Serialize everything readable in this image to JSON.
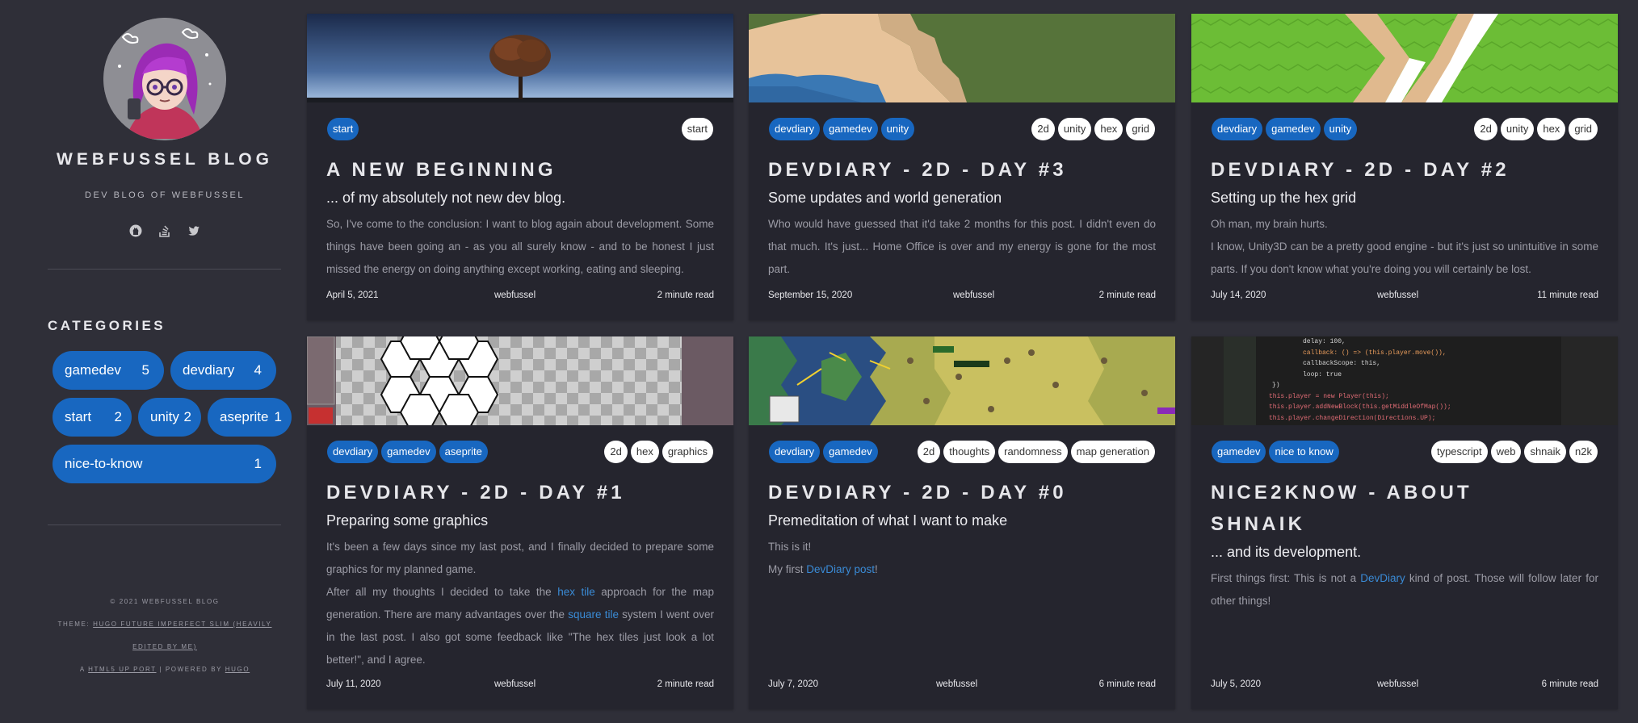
{
  "sidebar": {
    "title": "WEBFUSSEL BLOG",
    "subtitle": "DEV BLOG OF WEBFUSSEL",
    "social_icons": [
      "github-icon",
      "stack-overflow-icon",
      "twitter-icon"
    ],
    "categories_title": "CATEGORIES",
    "categories": [
      {
        "name": "gamedev",
        "count": "5"
      },
      {
        "name": "devdiary",
        "count": "4"
      },
      {
        "name": "start",
        "count": "2"
      },
      {
        "name": "unity",
        "count": "2"
      },
      {
        "name": "aseprite",
        "count": "1"
      },
      {
        "name": "nice-to-know",
        "count": "1"
      }
    ],
    "footer": {
      "copyright": "© 2021 WEBFUSSEL BLOG",
      "theme_prefix": "THEME:",
      "theme_link_1": "HUGO FUTURE IMPERFECT SLIM (HEAVILY",
      "theme_link_2": "EDITED BY ME)",
      "port_prefix": "A",
      "port_link": "HTML5 UP PORT",
      "powered": "| POWERED BY",
      "hugo_link": "HUGO"
    }
  },
  "posts": [
    {
      "title": "A NEW BEGINNING",
      "subtitle": "... of my absolutely not new dev blog.",
      "categories": [
        "start"
      ],
      "tags": [
        "start"
      ],
      "body": [
        "So, I've come to the conclusion: I want to blog again about development. Some things have been going an - as you all surely know - and to be honest I just missed the energy on doing anything except working, eating and sleeping."
      ],
      "date": "April 5, 2021",
      "author": "webfussel",
      "read": "2 minute read"
    },
    {
      "title": "DEVDIARY - 2D - DAY #3",
      "subtitle": "Some updates and world generation",
      "categories": [
        "devdiary",
        "gamedev",
        "unity"
      ],
      "tags": [
        "2d",
        "unity",
        "hex",
        "grid"
      ],
      "body": [
        "Who would have guessed that it'd take 2 months for this post. I didn't even do that much. It's just... Home Office is over and my energy is gone for the most part."
      ],
      "date": "September 15, 2020",
      "author": "webfussel",
      "read": "2 minute read"
    },
    {
      "title": "DEVDIARY - 2D - DAY #2",
      "subtitle": "Setting up the hex grid",
      "categories": [
        "devdiary",
        "gamedev",
        "unity"
      ],
      "tags": [
        "2d",
        "unity",
        "hex",
        "grid"
      ],
      "body": [
        "Oh man, my brain hurts.",
        "I know, Unity3D can be a pretty good engine - but it's just so unintuitive in some parts. If you don't know what you're doing you will certainly be lost."
      ],
      "date": "July 14, 2020",
      "author": "webfussel",
      "read": "11 minute read"
    },
    {
      "title": "DEVDIARY - 2D - DAY #1",
      "subtitle": "Preparing some graphics",
      "categories": [
        "devdiary",
        "gamedev",
        "aseprite"
      ],
      "tags": [
        "2d",
        "hex",
        "graphics"
      ],
      "body1": "It's been a few days since my last post, and I finally decided to prepare some graphics for my planned game.",
      "body2_a": "After all my thoughts I decided to take the ",
      "body2_link1": "hex tile",
      "body2_b": " approach for the map generation. There are many advantages over the ",
      "body2_link2": "square tile",
      "body2_c": " system I went over in the last post. I also got some feedback like \"The hex tiles just look a lot better!\", and I agree.",
      "date": "July 11, 2020",
      "author": "webfussel",
      "read": "2 minute read"
    },
    {
      "title": "DEVDIARY - 2D - DAY #0",
      "subtitle": "Premeditation of what I want to make",
      "categories": [
        "devdiary",
        "gamedev"
      ],
      "tags": [
        "2d",
        "thoughts",
        "randomness",
        "map generation"
      ],
      "body1": "This is it!",
      "body2_a": "My first ",
      "body2_link": "DevDiary post",
      "body2_b": "!",
      "date": "July 7, 2020",
      "author": "webfussel",
      "read": "6 minute read"
    },
    {
      "title_1": "NICE2KNOW - ABOUT",
      "title_2": "SHNAIK",
      "subtitle": "... and its development.",
      "categories": [
        "gamedev",
        "nice to know"
      ],
      "tags": [
        "typescript",
        "web",
        "shnaik",
        "n2k"
      ],
      "body_a": "First things first: This is not a ",
      "body_link": "DevDiary",
      "body_b": " kind of post. Those will follow later for other things!",
      "date": "July 5, 2020",
      "author": "webfussel",
      "read": "6 minute read"
    }
  ],
  "code_snippet": [
    "delay: 100,",
    "callback: () => (this.player.move()),",
    "callbackScope: this,",
    "loop: true",
    "})",
    "this.player = new Player(this);",
    "this.player.addNewBlock(this.getMiddleOfMap());",
    "this.player.changeDirection(Directions.UP);"
  ],
  "colors": {
    "accent": "#1867c0",
    "background": "#2f2f38",
    "card": "#25252e"
  }
}
